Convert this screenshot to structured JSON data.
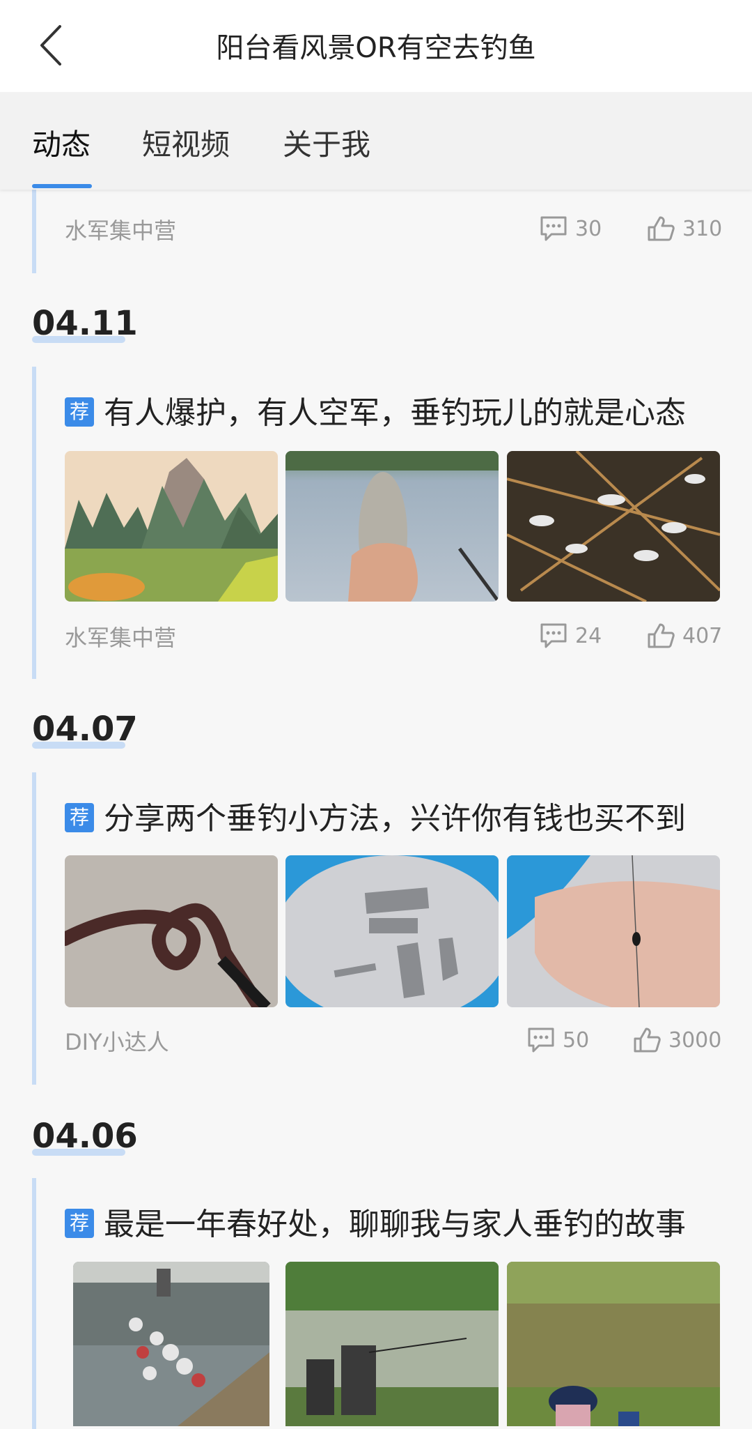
{
  "header": {
    "title": "阳台看风景OR有空去钓鱼"
  },
  "tabs": [
    {
      "label": "动态",
      "active": true
    },
    {
      "label": "短视频",
      "active": false
    },
    {
      "label": "关于我",
      "active": false
    }
  ],
  "feed": {
    "partial_post": {
      "author": "水军集中营",
      "comments": "30",
      "likes": "310"
    },
    "posts": [
      {
        "date": "04.11",
        "badge": "荐",
        "title": "有人爆护，有人空军，垂钓玩儿的就是心态",
        "author": "水军集中营",
        "comments": "24",
        "likes": "407"
      },
      {
        "date": "04.07",
        "badge": "荐",
        "title": "分享两个垂钓小方法，兴许你有钱也买不到",
        "author": "DIY小达人",
        "comments": "50",
        "likes": "3000"
      },
      {
        "date": "04.06",
        "badge": "荐",
        "title": "最是一年春好处，聊聊我与家人垂钓的故事"
      }
    ]
  },
  "colors": {
    "accent": "#3b8be8",
    "timeline": "#c8dcf5",
    "muted": "#999999"
  }
}
